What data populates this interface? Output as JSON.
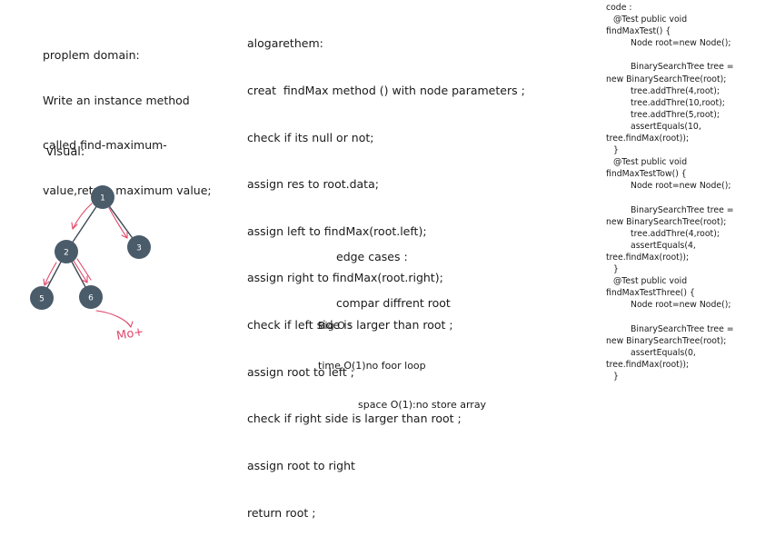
{
  "problem": {
    "lines": [
      "proplem domain:",
      "Write an instance method",
      "called find-maximum-",
      "value,return maximum value;"
    ]
  },
  "visual": {
    "label": "visual:",
    "nodes": [
      {
        "id": "n1",
        "label": "1"
      },
      {
        "id": "n2",
        "label": "2"
      },
      {
        "id": "n3",
        "label": "3"
      },
      {
        "id": "n5",
        "label": "5"
      },
      {
        "id": "n6",
        "label": "6"
      }
    ],
    "annotation": "Mo+",
    "colors": {
      "node": "#4a5b6a",
      "edge": "#3d4b57",
      "marker": "#e0476b"
    }
  },
  "algorithm": {
    "lines": [
      "alogarethem:",
      "creat  findMax method () with node parameters ;",
      "check if its null or not;",
      "assign res to root.data;",
      "assign left to findMax(root.left);",
      "assign right to findMax(root.right);",
      "check if left side is larger than root ;",
      "assign root to left ;",
      "check if right side is larger than root ;",
      "assign root to right",
      "return root ;"
    ]
  },
  "edge_cases": {
    "lines": [
      "edge cases :",
      "compar diffrent root"
    ]
  },
  "big_o": {
    "title": "Big O :",
    "time": "time O(1)no foor loop",
    "space": "space O(1):no store array"
  },
  "code": {
    "lines": [
      {
        "text": "code :",
        "indent": 0
      },
      {
        "text": "@Test public void",
        "indent": 1
      },
      {
        "text": "findMaxTest() {",
        "indent": 0
      },
      {
        "text": "Node root=new Node();",
        "indent": 2
      },
      {
        "text": "",
        "indent": 0
      },
      {
        "text": "BinarySearchTree tree =",
        "indent": 2
      },
      {
        "text": "new BinarySearchTree(root);",
        "indent": 0
      },
      {
        "text": "tree.addThre(4,root);",
        "indent": 2
      },
      {
        "text": "tree.addThre(10,root);",
        "indent": 2
      },
      {
        "text": "tree.addThre(5,root);",
        "indent": 2
      },
      {
        "text": "assertEquals(10,",
        "indent": 2
      },
      {
        "text": "tree.findMax(root));",
        "indent": 0
      },
      {
        "text": "}",
        "indent": 1
      },
      {
        "text": "@Test public void",
        "indent": 1
      },
      {
        "text": "findMaxTestTow() {",
        "indent": 0
      },
      {
        "text": "Node root=new Node();",
        "indent": 2
      },
      {
        "text": "",
        "indent": 0
      },
      {
        "text": "BinarySearchTree tree =",
        "indent": 2
      },
      {
        "text": "new BinarySearchTree(root);",
        "indent": 0
      },
      {
        "text": "tree.addThre(4,root);",
        "indent": 2
      },
      {
        "text": "assertEquals(4,",
        "indent": 2
      },
      {
        "text": "tree.findMax(root));",
        "indent": 0
      },
      {
        "text": "}",
        "indent": 1
      },
      {
        "text": "@Test public void",
        "indent": 1
      },
      {
        "text": "findMaxTestThree() {",
        "indent": 0
      },
      {
        "text": "Node root=new Node();",
        "indent": 2
      },
      {
        "text": "",
        "indent": 0
      },
      {
        "text": "BinarySearchTree tree =",
        "indent": 2
      },
      {
        "text": "new BinarySearchTree(root);",
        "indent": 0
      },
      {
        "text": "assertEquals(0,",
        "indent": 2
      },
      {
        "text": "tree.findMax(root));",
        "indent": 0
      },
      {
        "text": "}",
        "indent": 1
      }
    ]
  }
}
